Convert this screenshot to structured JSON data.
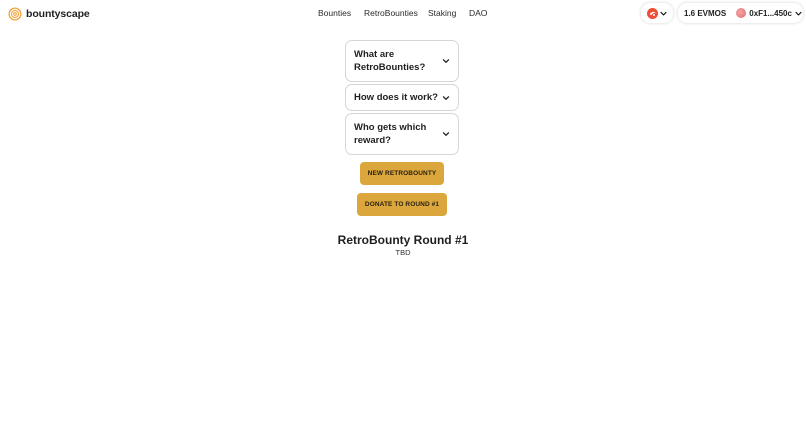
{
  "brand": {
    "name": "bountyscape",
    "logo_icon": "spiral-logo-icon",
    "accent": "#f2a33a"
  },
  "nav": {
    "items": [
      {
        "label": "Bounties"
      },
      {
        "label": "RetroBounties"
      },
      {
        "label": "Staking"
      },
      {
        "label": "DAO"
      }
    ]
  },
  "chain_selector": {
    "icon": "evmos-chain-icon",
    "chevron": "chevron-down-icon"
  },
  "wallet": {
    "balance": "1.6 EVMOS",
    "address": "0xF1...450c",
    "avatar_color": "#e87b7b"
  },
  "faq": [
    {
      "question": "What are RetroBounties?"
    },
    {
      "question": "How does it work?"
    },
    {
      "question": "Who gets which reward?"
    }
  ],
  "actions": {
    "new_label": "NEW RETROBOUNTY",
    "donate_label": "DONATE TO ROUND #1",
    "button_color": "#dba73c"
  },
  "round": {
    "title": "RetroBounty Round #1",
    "subtitle": "TBD"
  }
}
